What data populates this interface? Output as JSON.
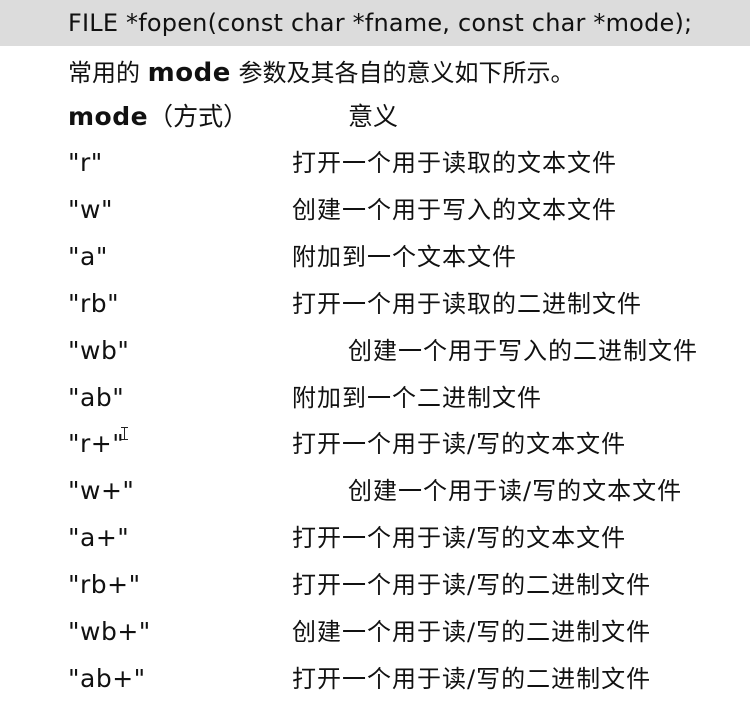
{
  "signature": "FILE *fopen(const char *fname, const char *mode);",
  "intro": {
    "before": "常用的",
    "keyword": "mode",
    "after": "参数及其各自的意义如下所示。"
  },
  "columns": {
    "mode_keyword": "mode",
    "mode_suffix": "（方式）",
    "meaning": "意义"
  },
  "rows": [
    {
      "mode": "\"r\"",
      "meaning": "打开一个用于读取的文本文件"
    },
    {
      "mode": "\"w\"",
      "meaning": "创建一个用于写入的文本文件"
    },
    {
      "mode": "\"a\"",
      "meaning": "附加到一个文本文件"
    },
    {
      "mode": "\"rb\"",
      "meaning": "打开一个用于读取的二进制文件"
    },
    {
      "mode": "\"wb\"",
      "meaning": "创建一个用于写入的二进制文件"
    },
    {
      "mode": "\"ab\"",
      "meaning": "附加到一个二进制文件"
    },
    {
      "mode": "\"r+\"",
      "meaning": "打开一个用于读/写的文本文件"
    },
    {
      "mode": "\"w+\"",
      "meaning": "创建一个用于读/写的文本文件"
    },
    {
      "mode": "\"a+\"",
      "meaning": "打开一个用于读/写的文本文件"
    },
    {
      "mode": "\"rb+\"",
      "meaning": "打开一个用于读/写的二进制文件"
    },
    {
      "mode": "\"wb+\"",
      "meaning": "创建一个用于读/写的二进制文件"
    },
    {
      "mode": "\"ab+\"",
      "meaning": "打开一个用于读/写的二进制文件"
    }
  ],
  "colors": {
    "header_background": "#dcdcdc",
    "text": "#111111"
  },
  "icons": {
    "cursor": "text-cursor-icon"
  }
}
